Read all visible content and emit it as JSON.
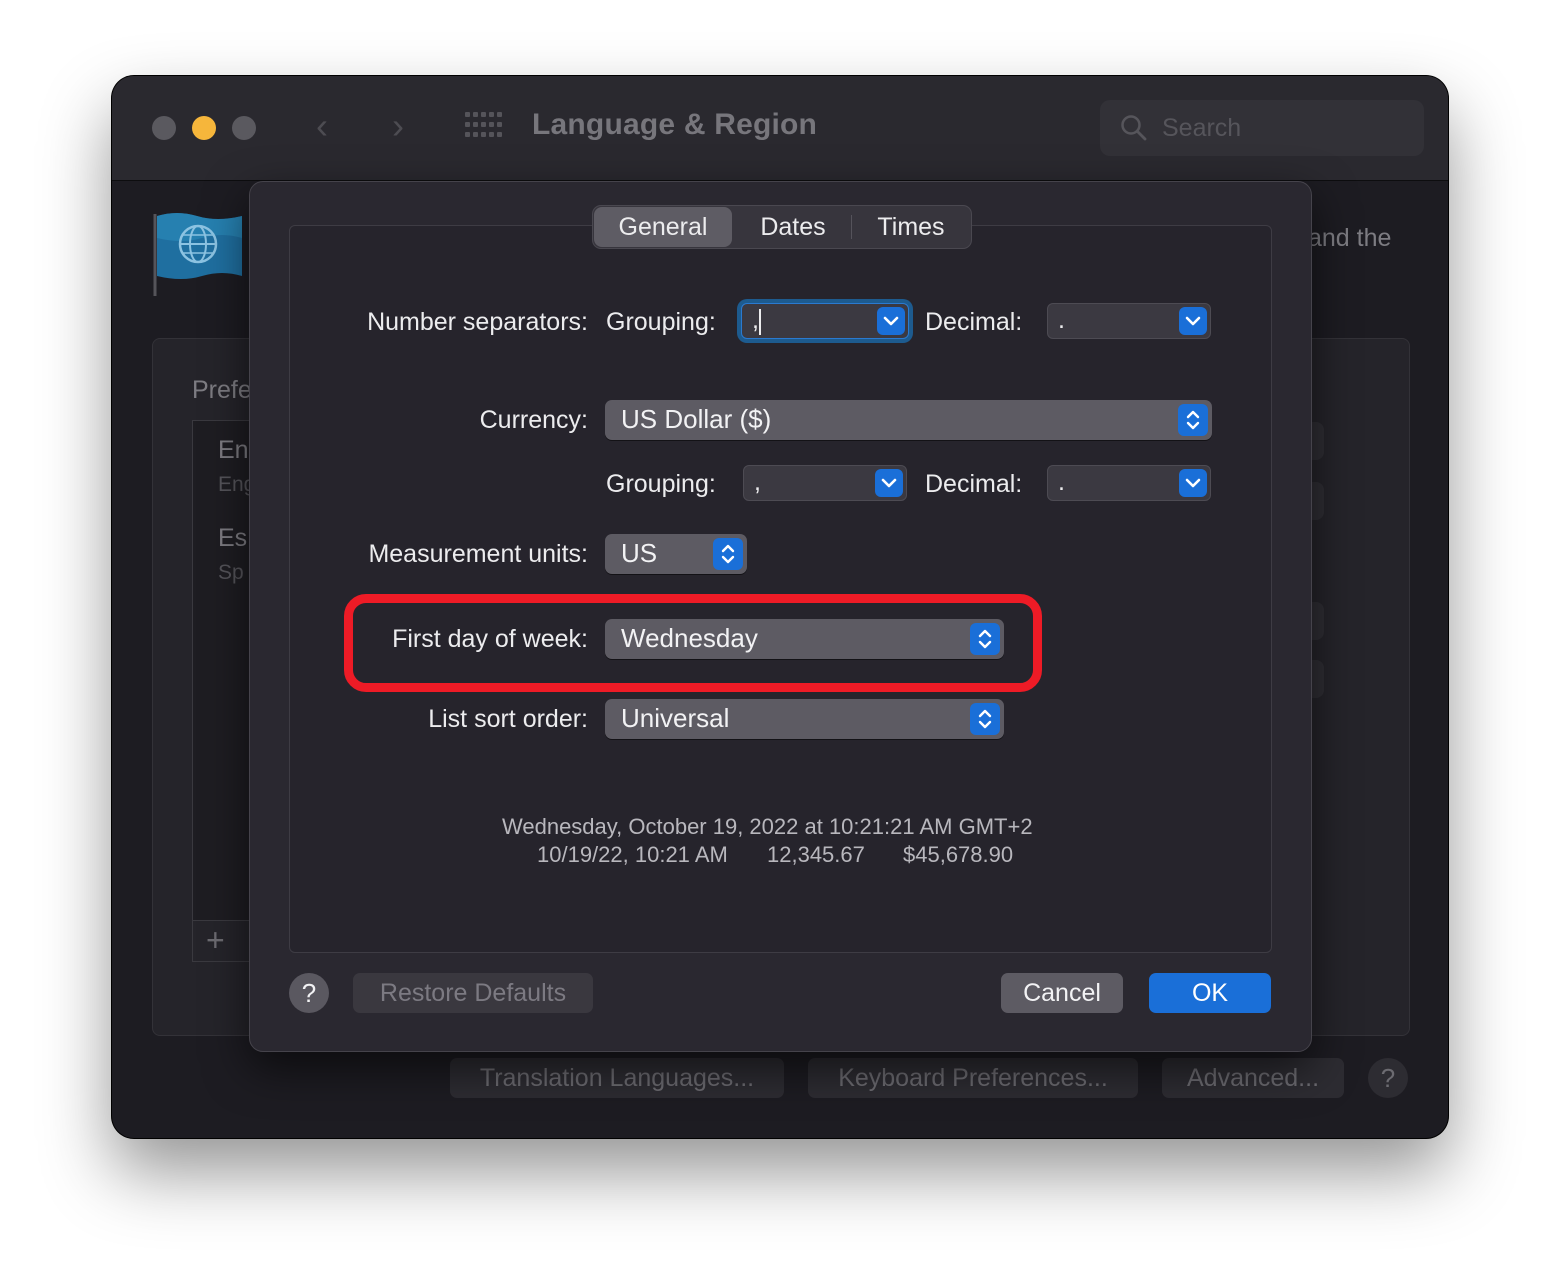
{
  "window": {
    "title": "Language & Region",
    "search_placeholder": "Search",
    "traffic_lights": {
      "close": "#5a595f",
      "minimize": "#f6b63b",
      "zoom": "#5a595f"
    }
  },
  "background": {
    "right_text": "and the",
    "preferred_label": "Prefe",
    "languages": [
      {
        "name": "En",
        "sub": "Eng"
      },
      {
        "name": "Es",
        "sub": "Sp"
      }
    ],
    "add_symbol": "+",
    "buttons": {
      "translation": "Translation Languages...",
      "keyboard": "Keyboard Preferences...",
      "advanced": "Advanced..."
    },
    "help": "?"
  },
  "sheet": {
    "tabs": [
      {
        "label": "General",
        "active": true
      },
      {
        "label": "Dates",
        "active": false
      },
      {
        "label": "Times",
        "active": false
      }
    ],
    "number_separators": {
      "label": "Number separators:",
      "grouping_label": "Grouping:",
      "grouping_value": ",",
      "decimal_label": "Decimal:",
      "decimal_value": "."
    },
    "currency": {
      "label": "Currency:",
      "value": "US Dollar ($)",
      "grouping_label": "Grouping:",
      "grouping_value": ",",
      "decimal_label": "Decimal:",
      "decimal_value": "."
    },
    "measurement": {
      "label": "Measurement units:",
      "value": "US"
    },
    "first_day": {
      "label": "First day of week:",
      "value": "Wednesday",
      "highlight_color": "#ee1b26"
    },
    "sort_order": {
      "label": "List sort order:",
      "value": "Universal"
    },
    "sample": {
      "line1": "Wednesday, October 19, 2022 at 10:21:21 AM GMT+2",
      "date_short": "10/19/22, 10:21 AM",
      "number": "12,345.67",
      "currency": "$45,678.90"
    },
    "help": "?",
    "restore_label": "Restore Defaults",
    "cancel_label": "Cancel",
    "ok_label": "OK",
    "accent_color": "#1a6fd8"
  }
}
